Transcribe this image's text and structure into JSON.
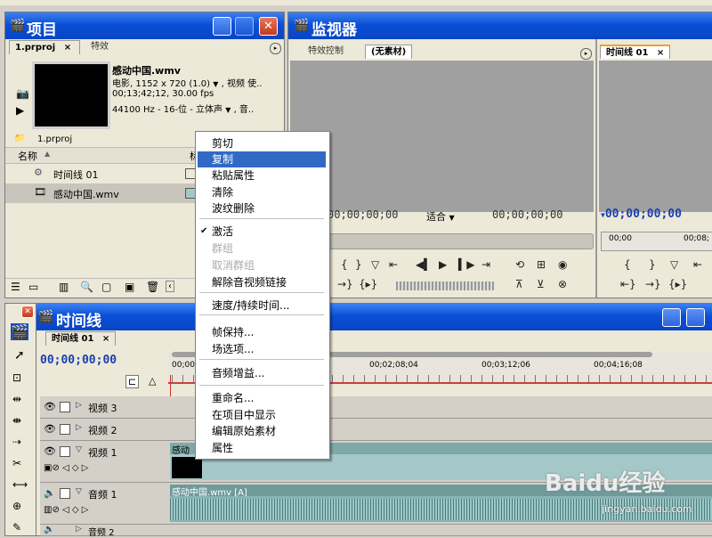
{
  "project": {
    "title": "项目",
    "tabs": [
      {
        "label": "1.prproj"
      },
      {
        "label": "特效"
      }
    ],
    "clip": {
      "name": "感动中国.wmv",
      "line1": "电影, 1152 x 720 (1.0)",
      "line1_suffix": ", 视频 使..",
      "line2": "00;13;42;12, 30.00 fps",
      "line3": "44100 Hz - 16-位 - 立体声",
      "line3_suffix": ", 音.."
    },
    "bin_name": "1.prproj",
    "columns": {
      "name": "名称",
      "label": "标"
    },
    "items": [
      {
        "label": "时间线 01"
      },
      {
        "label": "感动中国.wmv"
      }
    ]
  },
  "monitor": {
    "title": "监视器",
    "source_tabs": [
      {
        "label": "特效控制"
      },
      {
        "label": "(无素材)"
      }
    ],
    "source_timecode_left": "00;00;00;00",
    "fit_label": "适合",
    "source_timecode_right": "00;00;00;00",
    "program_tab": "时间线 01",
    "program_timecode": "00;00;00;00",
    "program_ruler_start": "00;00",
    "program_ruler_end": "00;08;"
  },
  "context_menu": {
    "items": [
      {
        "label": "剪切",
        "state": "normal"
      },
      {
        "label": "复制",
        "state": "highlighted"
      },
      {
        "label": "粘贴属性",
        "state": "normal"
      },
      {
        "label": "清除",
        "state": "normal"
      },
      {
        "label": "波纹删除",
        "state": "normal"
      },
      {
        "label": "激活",
        "state": "checked"
      },
      {
        "label": "群组",
        "state": "disabled"
      },
      {
        "label": "取消群组",
        "state": "disabled"
      },
      {
        "label": "解除音视频链接",
        "state": "normal"
      },
      {
        "label": "速度/持续时间...",
        "state": "normal"
      },
      {
        "label": "帧保持...",
        "state": "normal"
      },
      {
        "label": "场选项...",
        "state": "normal"
      },
      {
        "label": "音频增益...",
        "state": "normal"
      },
      {
        "label": "重命名...",
        "state": "normal"
      },
      {
        "label": "在项目中显示",
        "state": "normal"
      },
      {
        "label": "编辑原始素材",
        "state": "normal"
      },
      {
        "label": "属性",
        "state": "normal"
      }
    ],
    "check_mark": "✔"
  },
  "timeline": {
    "title": "时间线",
    "tab": "时间线 01",
    "timecode": "00;00;00;00",
    "ruler_labels": [
      "00;00",
      "00;02;08;04",
      "00;03;12;06",
      "00;04;16;08"
    ],
    "tracks": [
      {
        "label": "视频 3"
      },
      {
        "label": "视频 2"
      },
      {
        "label": "视频 1"
      },
      {
        "label": "音频 1"
      },
      {
        "label": "音频 2"
      }
    ],
    "video_clip_label": "感动",
    "audio_clip_label": "感动中国.wmv [A]"
  },
  "watermark": {
    "brand": "Baidu经验",
    "url": "jingyan.baidu.com"
  },
  "colors": {
    "title_blue": "#0a4fd6",
    "highlight": "#316ac5",
    "timecode_blue": "#1a3fb0",
    "clip_teal": "#a4c8c8"
  }
}
